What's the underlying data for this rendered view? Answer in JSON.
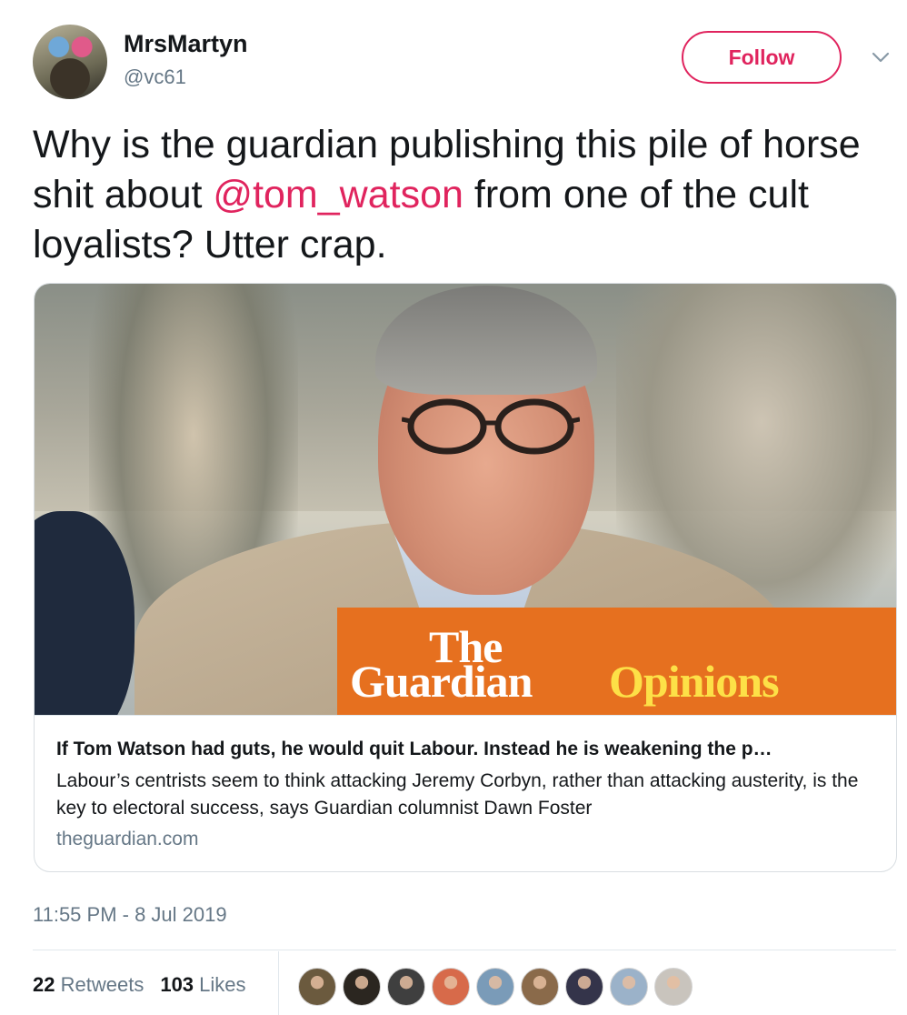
{
  "user": {
    "display_name": "MrsMartyn",
    "handle": "@vc61",
    "follow_label": "Follow"
  },
  "tweet": {
    "text_before": "Why is the guardian publishing this pile of horse shit about ",
    "mention": "@tom_watson",
    "text_after": " from one of the cult loyalists? Utter crap."
  },
  "card": {
    "image_brand_the": "The",
    "image_brand_guardian": "Guardian",
    "image_brand_opinions": "Opinions",
    "title": "If Tom Watson had guts, he would quit Labour. Instead he is weakening the p…",
    "description": "Labour’s centrists seem to think attacking Jeremy Corbyn, rather than attacking austerity, is the key to electoral success, says Guardian columnist Dawn Foster",
    "domain": "theguardian.com"
  },
  "timestamp": "11:55 PM - 8 Jul 2019",
  "stats": {
    "retweets_count": "22",
    "retweets_label": "Retweets",
    "likes_count": "103",
    "likes_label": "Likes"
  },
  "likers": [
    {
      "color": "#6b5a3e"
    },
    {
      "color": "#2b2620"
    },
    {
      "color": "#3f3f3f"
    },
    {
      "color": "#d76a4a"
    },
    {
      "color": "#7a9bb8"
    },
    {
      "color": "#8a6a4a"
    },
    {
      "color": "#34344a"
    },
    {
      "color": "#9bb2c9"
    },
    {
      "color": "#c9c4bd"
    }
  ],
  "colors": {
    "accent": "#e0245e",
    "secondary_text": "#657786",
    "guardian_orange": "#e6701f",
    "opinions_yellow": "#fde047"
  },
  "icons": {
    "caret": "chevron-down-icon"
  }
}
